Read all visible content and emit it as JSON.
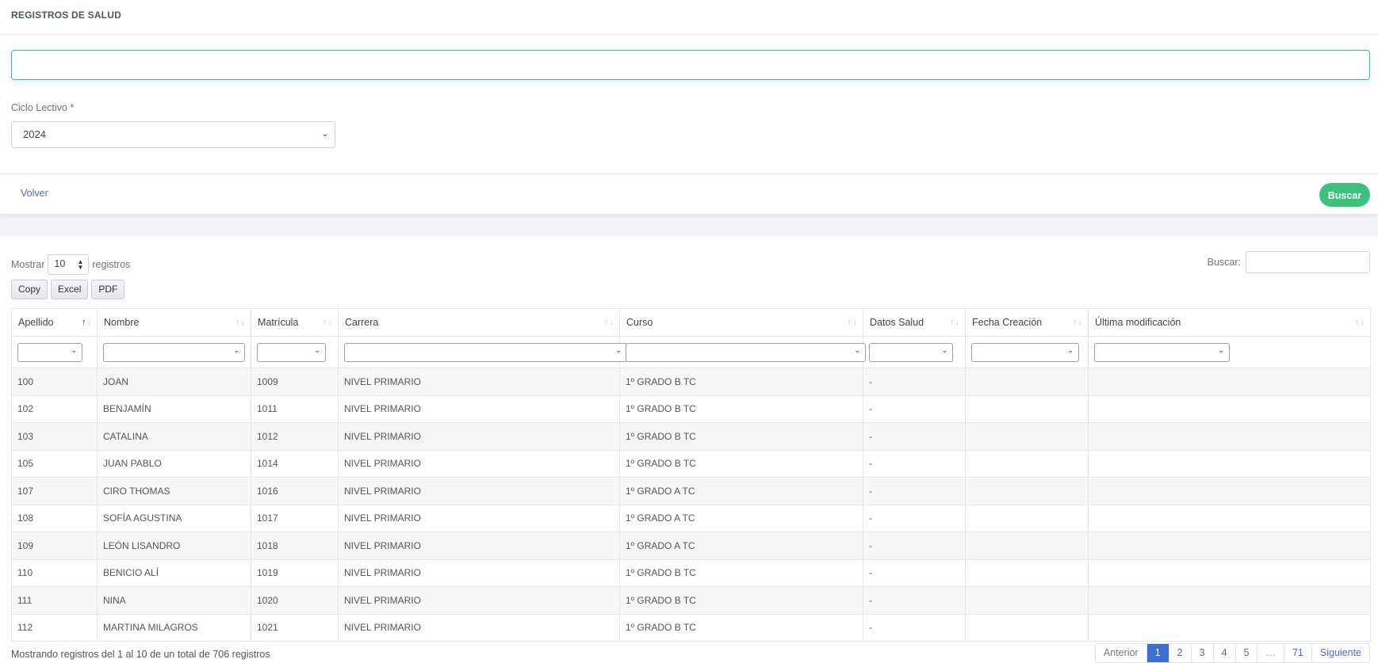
{
  "header": {
    "title": "REGISTROS DE SALUD"
  },
  "form": {
    "big_input_value": "",
    "ciclo_label": "Ciclo Lectivo",
    "required_mark": "*",
    "ciclo_value": "2024",
    "volver_label": "Volver",
    "buscar_label": "Buscar"
  },
  "table_controls": {
    "mostrar_label": "Mostrar",
    "page_length": "10",
    "registros_label": "registros",
    "search_label": "Buscar:",
    "search_value": "",
    "buttons": [
      "Copy",
      "Excel",
      "PDF"
    ]
  },
  "table": {
    "columns": [
      "Apellido",
      "Nombre",
      "Matrícula",
      "Carrera",
      "Curso",
      "Datos Salud",
      "Fecha Creación",
      "Última modificación"
    ],
    "rows": [
      [
        "100",
        "JOAN",
        "1009",
        "NIVEL PRIMARIO",
        "1º GRADO B TC",
        "-",
        "",
        ""
      ],
      [
        "102",
        "BENJAMÍN",
        "1011",
        "NIVEL PRIMARIO",
        "1º GRADO B TC",
        "-",
        "",
        ""
      ],
      [
        "103",
        "CATALINA",
        "1012",
        "NIVEL PRIMARIO",
        "1º GRADO B TC",
        "-",
        "",
        ""
      ],
      [
        "105",
        "JUAN PABLO",
        "1014",
        "NIVEL PRIMARIO",
        "1º GRADO B TC",
        "-",
        "",
        ""
      ],
      [
        "107",
        "CIRO THOMAS",
        "1016",
        "NIVEL PRIMARIO",
        "1º GRADO A TC",
        "-",
        "",
        ""
      ],
      [
        "108",
        "SOFÍA AGUSTINA",
        "1017",
        "NIVEL PRIMARIO",
        "1º GRADO A TC",
        "-",
        "",
        ""
      ],
      [
        "109",
        "LEÓN LISANDRO",
        "1018",
        "NIVEL PRIMARIO",
        "1º GRADO A TC",
        "-",
        "",
        ""
      ],
      [
        "110",
        "BENICIO ALÍ",
        "1019",
        "NIVEL PRIMARIO",
        "1º GRADO B TC",
        "-",
        "",
        ""
      ],
      [
        "111",
        "NINA",
        "1020",
        "NIVEL PRIMARIO",
        "1º GRADO B TC",
        "-",
        "",
        ""
      ],
      [
        "112",
        "MARTINA MILAGROS",
        "1021",
        "NIVEL PRIMARIO",
        "1º GRADO B TC",
        "-",
        "",
        ""
      ]
    ]
  },
  "footer": {
    "info": "Mostrando registros del 1 al 10 de un total de 706 registros",
    "pagination": [
      "Anterior",
      "1",
      "2",
      "3",
      "4",
      "5",
      "…",
      "71",
      "Siguiente"
    ],
    "active_page": "1"
  },
  "colors": {
    "accent": "#3bc27d",
    "link": "#4a6ad6",
    "active_page": "#3b6fd6",
    "input_focus": "#38b2c6"
  }
}
